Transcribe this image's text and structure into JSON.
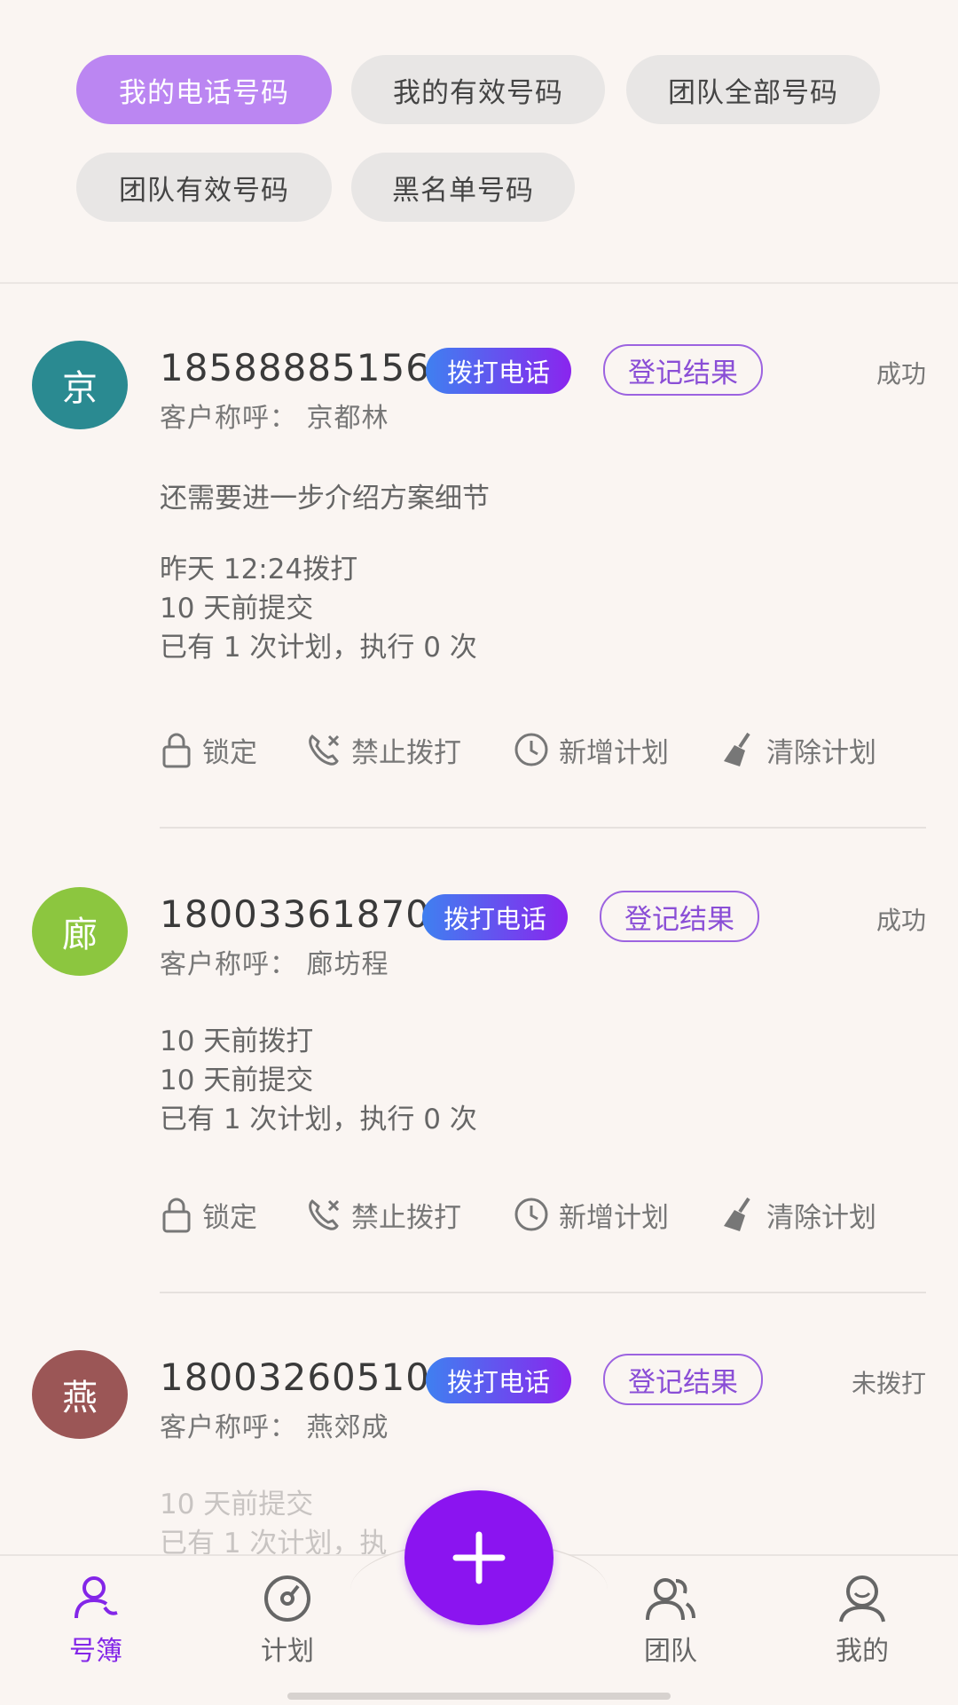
{
  "filters": [
    {
      "label": "我的电话号码",
      "active": true
    },
    {
      "label": "我的有效号码",
      "active": false
    },
    {
      "label": "团队全部号码",
      "active": false
    },
    {
      "label": "团队有效号码",
      "active": false
    },
    {
      "label": "黑名单号码",
      "active": false
    }
  ],
  "labels": {
    "call": "拨打电话",
    "result": "登记结果",
    "lock": "锁定",
    "forbid": "禁止拨打",
    "add_plan": "新增计划",
    "clear_plan": "清除计划"
  },
  "records": [
    {
      "avatar_char": "京",
      "avatar_color": "#2a8a91",
      "phone": "18588885156",
      "status": "成功",
      "name": "客户称呼：  京都林",
      "note": "还需要进一步介绍方案细节",
      "lines": [
        "昨天  12:24拨打",
        "10  天前提交",
        "已有  1  次计划，执行  0  次"
      ]
    },
    {
      "avatar_char": "廊",
      "avatar_color": "#8cc63f",
      "phone": "18003361870",
      "status": "成功",
      "name": "客户称呼：  廊坊程",
      "note": "",
      "lines": [
        "10  天前拨打",
        "10  天前提交",
        "已有  1  次计划，执行  0  次"
      ]
    },
    {
      "avatar_char": "燕",
      "avatar_color": "#9b5656",
      "phone": "18003260510",
      "status": "未拨打",
      "name": "客户称呼：  燕郊成",
      "note": "",
      "lines": [
        "10  天前提交",
        "已有  1  次计划，执"
      ]
    }
  ],
  "nav": {
    "items": [
      {
        "label": "号簿",
        "active": true
      },
      {
        "label": "计划",
        "active": false
      },
      {
        "label": "团队",
        "active": false
      },
      {
        "label": "我的",
        "active": false
      }
    ],
    "accent": "#8326e8"
  }
}
